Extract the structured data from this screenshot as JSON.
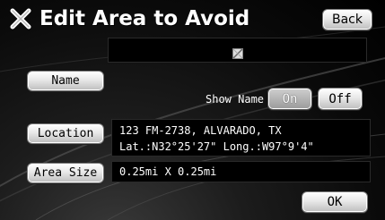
{
  "screen": {
    "title": "Edit Area to Avoid",
    "back_label": "Back"
  },
  "name_section": {
    "button_label": "Name",
    "show_name_label": "Show Name",
    "on_label": "On",
    "off_label": "Off",
    "selected": "On"
  },
  "location_section": {
    "button_label": "Location",
    "address": "123 FM-2738, ALVARADO, TX",
    "coords": "Lat.:N32°25'27\" Long.:W97°9'4\""
  },
  "area_section": {
    "button_label": "Area Size",
    "value": "0.25mi X 0.25mi"
  },
  "footer": {
    "ok_label": "OK"
  },
  "icons": {
    "title_icon": "x-cross-icon",
    "name_placeholder_icon": "broken-image-icon"
  }
}
